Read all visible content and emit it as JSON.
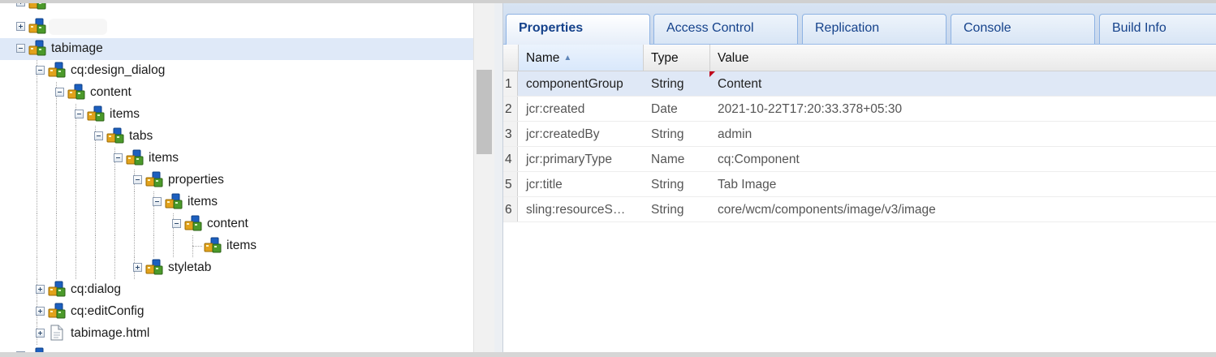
{
  "tree": {
    "nodes": [
      {
        "label": "",
        "toggle": "plus"
      },
      {
        "label": "",
        "toggle": "plus",
        "redacted": true
      },
      {
        "label": "tabimage",
        "toggle": "minus",
        "selected": true
      },
      {
        "label": "cq:design_dialog",
        "toggle": "minus"
      },
      {
        "label": "content",
        "toggle": "minus"
      },
      {
        "label": "items",
        "toggle": "minus"
      },
      {
        "label": "tabs",
        "toggle": "minus"
      },
      {
        "label": "items",
        "toggle": "minus"
      },
      {
        "label": "properties",
        "toggle": "minus"
      },
      {
        "label": "items",
        "toggle": "minus"
      },
      {
        "label": "content",
        "toggle": "minus"
      },
      {
        "label": "items",
        "toggle": "none"
      },
      {
        "label": "styletab",
        "toggle": "plus"
      },
      {
        "label": "cq:dialog",
        "toggle": "plus"
      },
      {
        "label": "cq:editConfig",
        "toggle": "plus"
      },
      {
        "label": "tabimage.html",
        "toggle": "plus",
        "icon": "file-icon"
      },
      {
        "label": "",
        "toggle": "plus"
      }
    ]
  },
  "tabs": [
    {
      "label": "Properties",
      "active": true
    },
    {
      "label": "Access Control"
    },
    {
      "label": "Replication"
    },
    {
      "label": "Console"
    },
    {
      "label": "Build Info"
    }
  ],
  "grid": {
    "columns": [
      "Name",
      "Type",
      "Value"
    ],
    "sort_indicator": "▲",
    "rows": [
      {
        "num": "1",
        "name": "componentGroup",
        "type": "String",
        "value": "Content",
        "selected": true,
        "modified": true
      },
      {
        "num": "2",
        "name": "jcr:created",
        "type": "Date",
        "value": "2021-10-22T17:20:33.378+05:30"
      },
      {
        "num": "3",
        "name": "jcr:createdBy",
        "type": "String",
        "value": "admin"
      },
      {
        "num": "4",
        "name": "jcr:primaryType",
        "type": "Name",
        "value": "cq:Component"
      },
      {
        "num": "5",
        "name": "jcr:title",
        "type": "String",
        "value": "Tab Image"
      },
      {
        "num": "6",
        "name": "sling:resourceS…",
        "type": "String",
        "value": "core/wcm/components/image/v3/image"
      }
    ]
  },
  "colors": {
    "selection": "#dfe9f8",
    "tab_text": "#15428b",
    "node_blue": "#1c5fbf",
    "node_gold": "#e2a21b",
    "node_green": "#4b9a2a",
    "modified_marker": "#c0001c"
  }
}
